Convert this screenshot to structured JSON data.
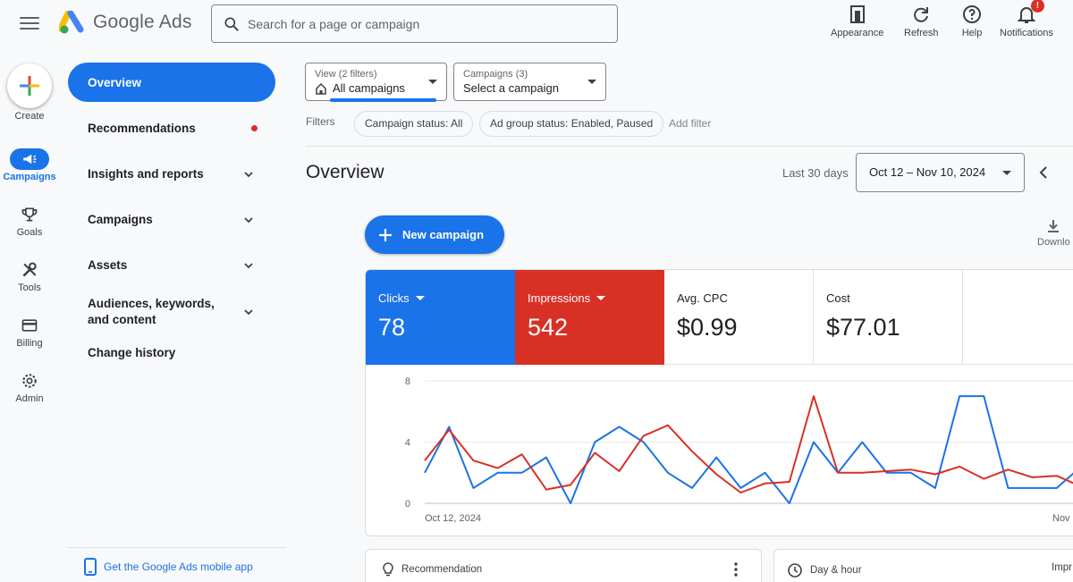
{
  "header": {
    "brand": "Google Ads",
    "search_placeholder": "Search for a page or campaign",
    "tools": [
      {
        "label": "Appearance",
        "icon": "appearance-icon"
      },
      {
        "label": "Refresh",
        "icon": "refresh-icon"
      },
      {
        "label": "Help",
        "icon": "help-icon"
      },
      {
        "label": "Notifications",
        "icon": "notifications-icon",
        "badge": "!"
      }
    ]
  },
  "rail": {
    "create_label": "Create",
    "items": [
      {
        "label": "Campaigns",
        "icon": "megaphone-icon",
        "active": true
      },
      {
        "label": "Goals",
        "icon": "trophy-icon"
      },
      {
        "label": "Tools",
        "icon": "tools-icon"
      },
      {
        "label": "Billing",
        "icon": "billing-card-icon"
      },
      {
        "label": "Admin",
        "icon": "admin-gear-icon"
      }
    ]
  },
  "nav": {
    "items": [
      {
        "label": "Overview"
      },
      {
        "label": "Recommendations"
      },
      {
        "label": "Insights and reports"
      },
      {
        "label": "Campaigns"
      },
      {
        "label": "Assets"
      },
      {
        "label": "Audiences, keywords, and content"
      },
      {
        "label": "Change history"
      }
    ],
    "mobile_app": "Get the Google Ads mobile app"
  },
  "filters": {
    "view_small": "View (2 filters)",
    "view_value": "All campaigns",
    "campaigns_small": "Campaigns (3)",
    "campaigns_value": "Select a campaign",
    "label": "Filters",
    "chips": [
      "Campaign status: All",
      "Ad group status: Enabled, Paused"
    ],
    "add_filter": "Add filter"
  },
  "overview": {
    "title": "Overview",
    "range_label": "Last 30 days",
    "date_range": "Oct 12 – Nov 10, 2024",
    "new_campaign": "+ New campaign",
    "new_campaign_text": "New campaign",
    "download": "Downlo"
  },
  "scorecards": [
    {
      "label": "Clicks",
      "value": "78",
      "color": "#1a73e8"
    },
    {
      "label": "Impressions",
      "value": "542",
      "color": "#d93025"
    },
    {
      "label": "Avg. CPC",
      "value": "$0.99"
    },
    {
      "label": "Cost",
      "value": "$77.01"
    }
  ],
  "chart_data": {
    "type": "line",
    "y_ticks": [
      "8",
      "4",
      "0"
    ],
    "ylim": [
      0,
      8
    ],
    "x_tick_labels": [
      "Oct 12, 2024",
      "Nov"
    ],
    "grid": true,
    "series": [
      {
        "key": "clicks",
        "color": "#1a73e8",
        "values": [
          2,
          5,
          1,
          2,
          2,
          3,
          0,
          4,
          5,
          4,
          2,
          1,
          3,
          1,
          2,
          0,
          4,
          2,
          4,
          2,
          2,
          1,
          7,
          7,
          1,
          1,
          1,
          2.4
        ]
      },
      {
        "key": "impressions",
        "color": "#d93025",
        "values": [
          2.8,
          4.8,
          2.8,
          2.3,
          3.2,
          0.9,
          1.2,
          3.3,
          2.1,
          4.4,
          5.1,
          3.4,
          1.9,
          0.7,
          1.3,
          1.4,
          7,
          2,
          2,
          2.1,
          2.2,
          1.9,
          2.4,
          1.6,
          2.2,
          1.7,
          1.8,
          1.1
        ]
      }
    ]
  },
  "bottom_cards": [
    {
      "title": "Recommendation",
      "icon": "lightbulb-icon"
    },
    {
      "title": "Day & hour",
      "icon": "clock-icon",
      "right": "Impr"
    }
  ]
}
